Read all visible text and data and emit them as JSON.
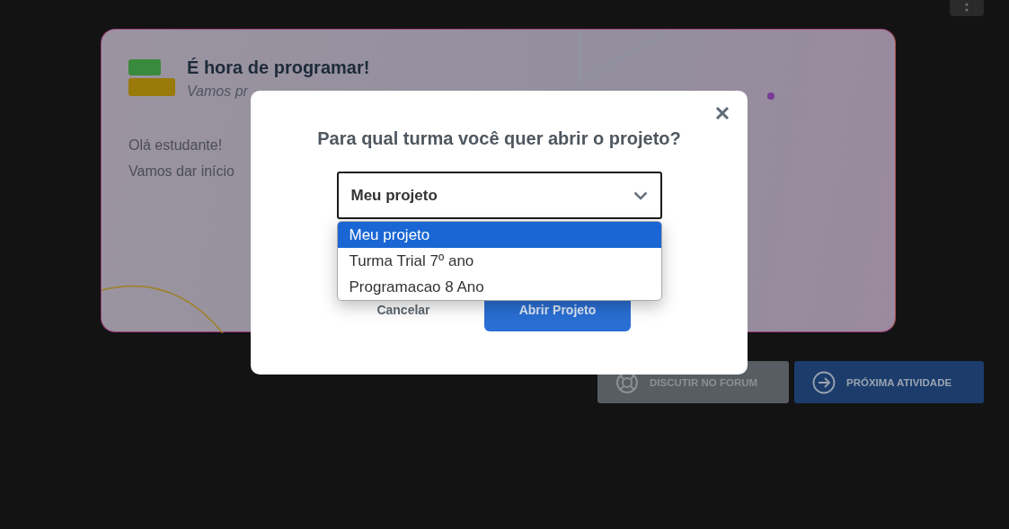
{
  "card": {
    "title": "É hora de programar!",
    "subtitle": "Vamos pr",
    "body": [
      "Olá estudante!",
      "Vamos dar início"
    ]
  },
  "actions": [
    {
      "kind": "forum",
      "label": "DISCUTIR NO FORUM"
    },
    {
      "kind": "next",
      "label": "PRÓXIMA ATIVIDADE"
    }
  ],
  "dialog": {
    "title": "Para qual turma você quer abrir o projeto?",
    "select": {
      "value": "Meu projeto",
      "expanded": true
    },
    "options": [
      {
        "label": "Meu projeto",
        "selected": true
      },
      {
        "label": "Turma Trial 7º ano",
        "selected": false
      },
      {
        "label": "Programacao 8 Ano",
        "selected": false
      }
    ],
    "buttons": [
      {
        "kind": "secondary",
        "label": "Cancelar"
      },
      {
        "kind": "primary",
        "label": "Abrir Projeto"
      }
    ]
  }
}
